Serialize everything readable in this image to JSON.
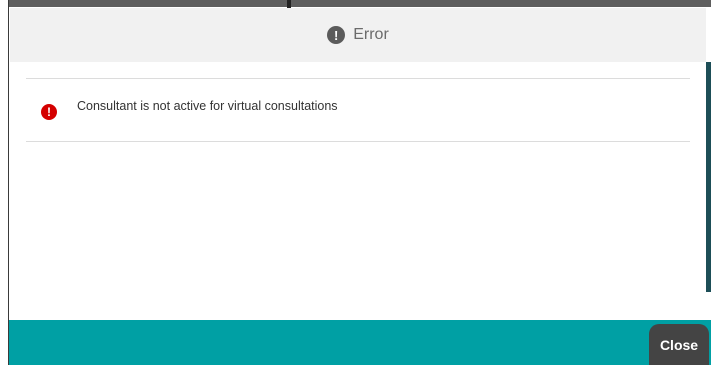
{
  "dialog": {
    "title": "Error",
    "header_icon": "exclamation-circle-icon",
    "message": "Consultant is not active for virtual consultations",
    "message_icon": "exclamation-circle-icon",
    "icon_glyph": "!"
  },
  "footer": {
    "close_label": "Close"
  },
  "colors": {
    "error_red": "#d40000",
    "footer_teal": "#00a0a4",
    "header_bg": "#f1f1f1",
    "close_button_bg": "#444444"
  }
}
